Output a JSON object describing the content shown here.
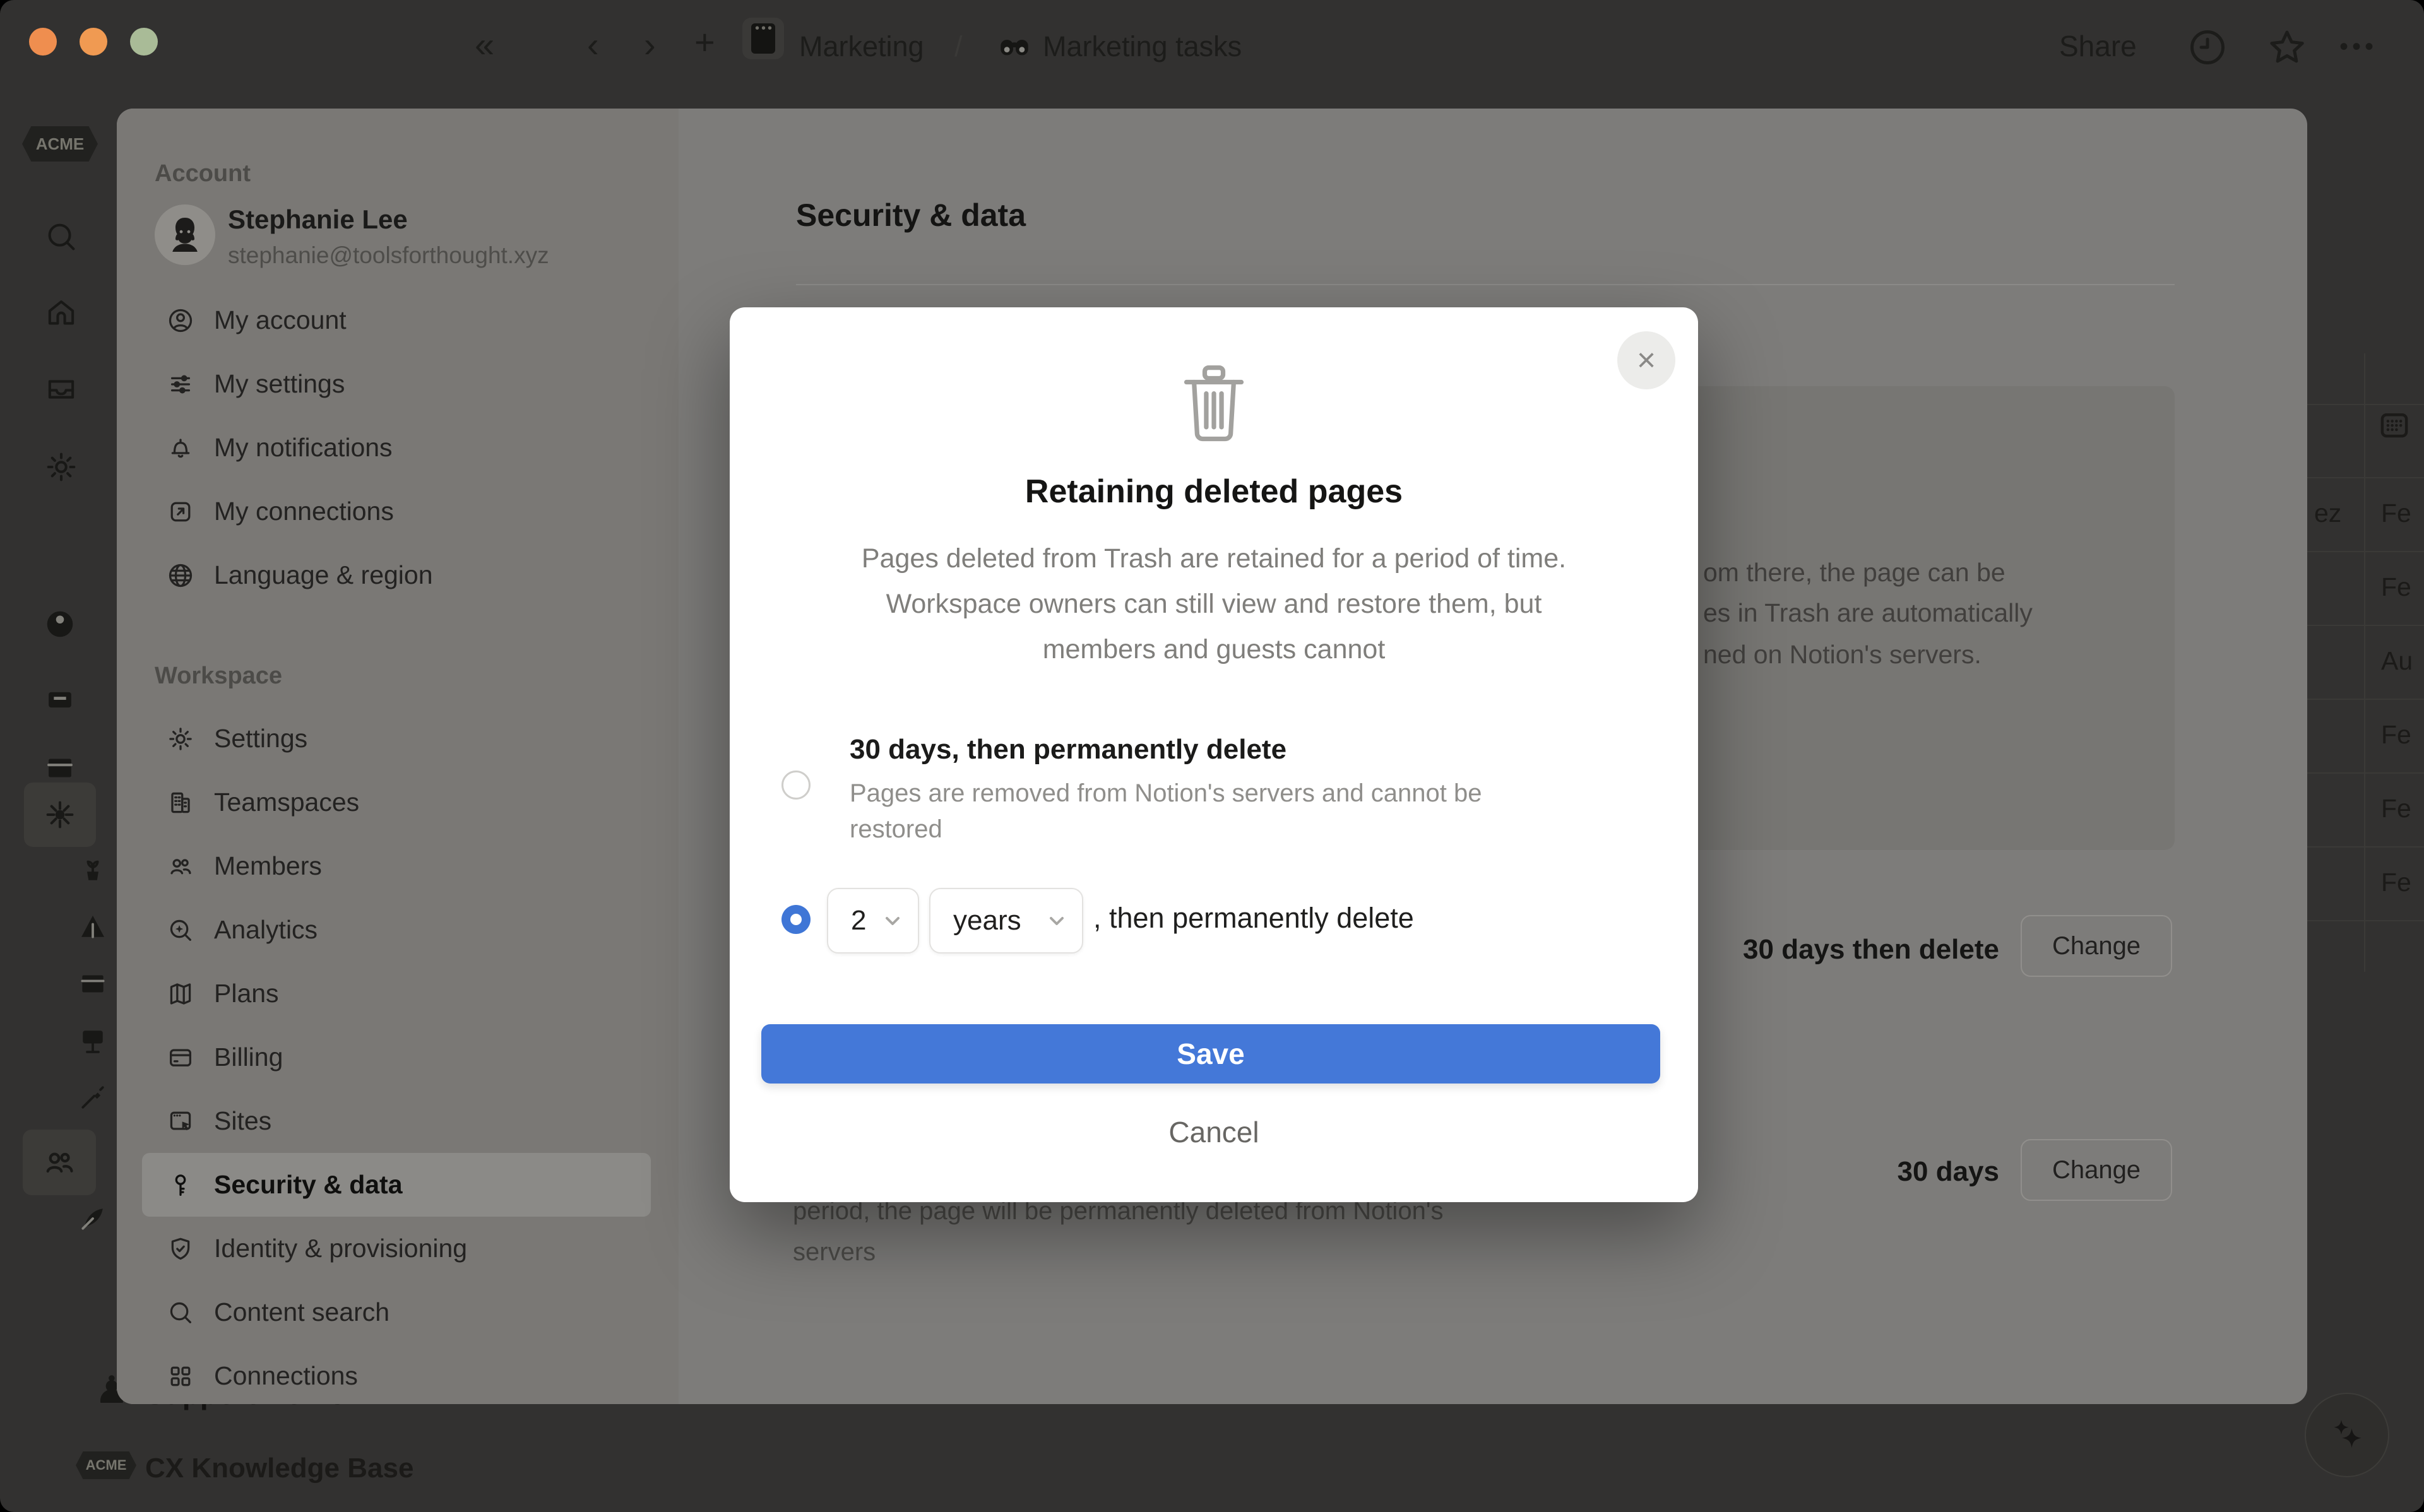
{
  "window": {
    "traffic_colors": [
      "#ef8e4f",
      "#f09a52",
      "#a9bb97"
    ]
  },
  "topbar": {
    "nav_collapse": "«",
    "nav_back": "‹",
    "nav_forward": "›",
    "nav_add": "+",
    "breadcrumb_root": "Marketing",
    "breadcrumb_sep": "/",
    "breadcrumb_page": "Marketing tasks",
    "share": "Share",
    "more": "•••"
  },
  "rail": {
    "logo": "ACME",
    "pawn": "♟",
    "support": "Support Home",
    "kb": "CX Knowledge Base"
  },
  "settings": {
    "account_label": "Account",
    "user": {
      "name": "Stephanie Lee",
      "email": "stephanie@toolsforthought.xyz"
    },
    "account_items": [
      {
        "icon": "person-circle",
        "label": "My account"
      },
      {
        "icon": "sliders",
        "label": "My settings"
      },
      {
        "icon": "bell",
        "label": "My notifications"
      },
      {
        "icon": "arrow-box",
        "label": "My connections"
      },
      {
        "icon": "globe",
        "label": "Language & region"
      }
    ],
    "workspace_label": "Workspace",
    "workspace_items": [
      {
        "icon": "gear",
        "label": "Settings"
      },
      {
        "icon": "building",
        "label": "Teamspaces"
      },
      {
        "icon": "people",
        "label": "Members"
      },
      {
        "icon": "analytics",
        "label": "Analytics"
      },
      {
        "icon": "map",
        "label": "Plans"
      },
      {
        "icon": "card",
        "label": "Billing"
      },
      {
        "icon": "sites",
        "label": "Sites"
      },
      {
        "icon": "key",
        "label": "Security & data",
        "selected": true
      },
      {
        "icon": "shield",
        "label": "Identity & provisioning"
      },
      {
        "icon": "search",
        "label": "Content search"
      },
      {
        "icon": "grid",
        "label": "Connections"
      }
    ],
    "content": {
      "heading": "Security & data",
      "info_lines": [
        "om there, the page can be",
        "es in Trash are automatically",
        "ned on Notion's servers."
      ],
      "retention_value": "30 days then delete",
      "retention_button": "Change",
      "trash_value": "30 days",
      "trash_button": "Change",
      "undermodal_lines": [
        "period, the page will be permanently deleted from Notion's",
        "servers"
      ]
    }
  },
  "modal": {
    "close": "×",
    "title": "Retaining deleted pages",
    "desc_lines": [
      "Pages deleted from Trash are retained for a period of time.",
      "Workspace owners can still view and restore them, but",
      "members and guests cannot"
    ],
    "option1": {
      "title": "30 days, then permanently delete",
      "sub_lines": [
        "Pages are removed from Notion's servers and cannot be",
        "restored"
      ]
    },
    "option2": {
      "number": "2",
      "unit": "years",
      "suffix": ", then permanently delete"
    },
    "save": "Save",
    "cancel": "Cancel"
  },
  "behind_table": {
    "left_fragments": [
      "ez"
    ],
    "right_fragments": [
      "Fe",
      "Fe",
      "Au",
      "Fe",
      "Fe",
      "Fe"
    ]
  },
  "colors": {
    "radio_blue": "#3f76d6",
    "save_blue": "#4478d8"
  }
}
